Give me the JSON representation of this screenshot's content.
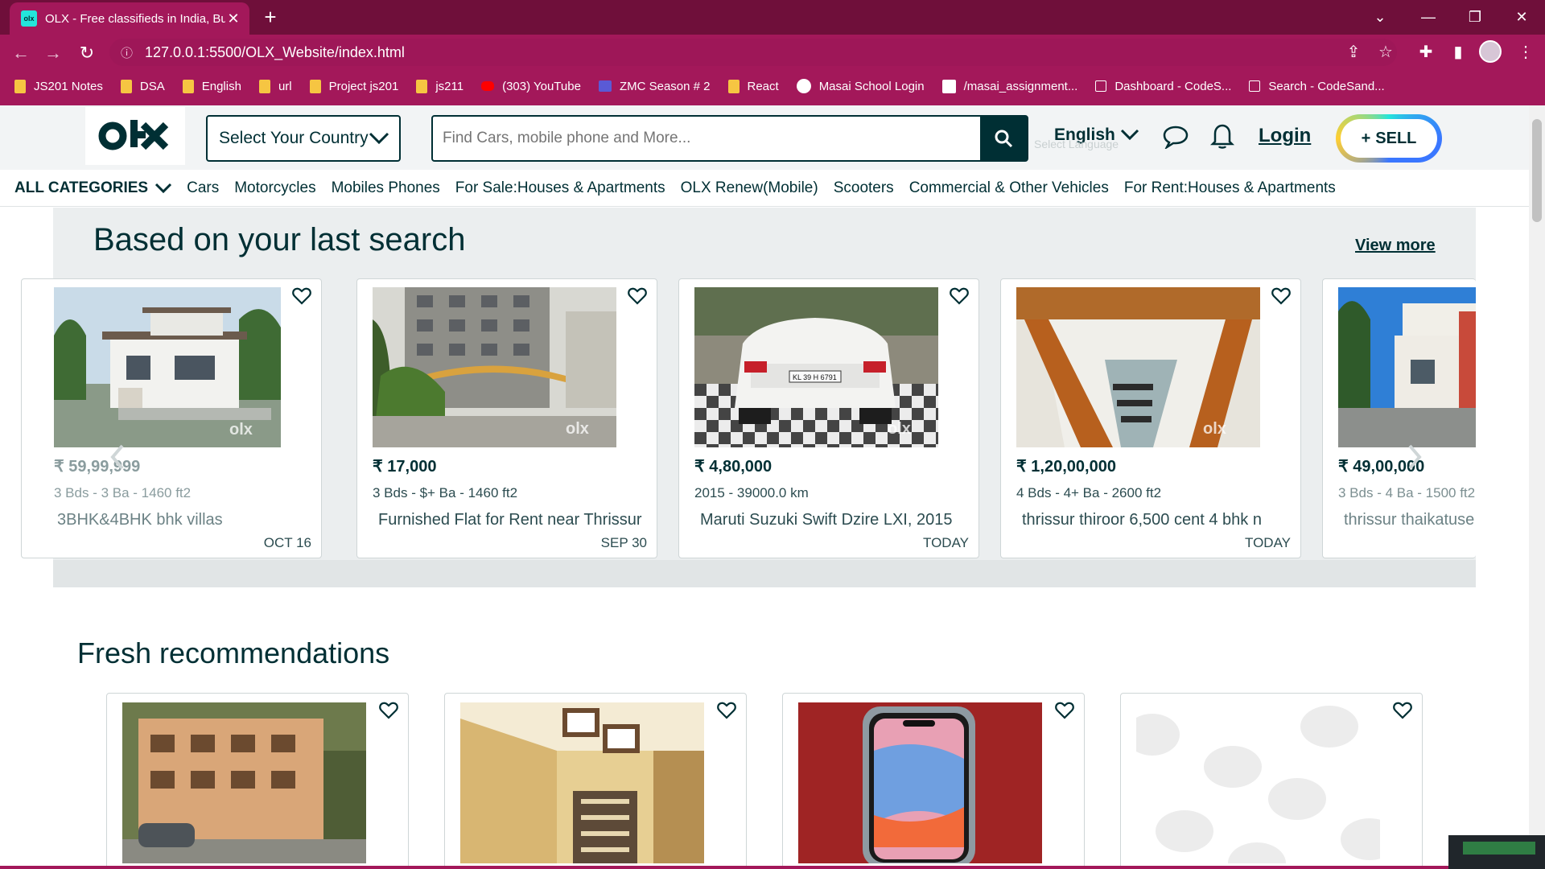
{
  "browser": {
    "tab_title": "OLX - Free classifieds in India, Bu",
    "tab_favicon": "olx",
    "url": "127.0.0.1:5500/OLX_Website/index.html",
    "bookmarks": [
      {
        "label": "JS201 Notes",
        "icon": "folder"
      },
      {
        "label": "DSA",
        "icon": "folder"
      },
      {
        "label": "English",
        "icon": "folder"
      },
      {
        "label": "url",
        "icon": "folder"
      },
      {
        "label": "Project js201",
        "icon": "folder"
      },
      {
        "label": "js211",
        "icon": "folder"
      },
      {
        "label": "(303) YouTube",
        "icon": "youtube"
      },
      {
        "label": "ZMC Season # 2",
        "icon": "zmc"
      },
      {
        "label": "React",
        "icon": "folder"
      },
      {
        "label": "Masai School Login",
        "icon": "masai"
      },
      {
        "label": "/masai_assignment...",
        "icon": "wikipedia"
      },
      {
        "label": "Dashboard - CodeS...",
        "icon": "page"
      },
      {
        "label": "Search - CodeSand...",
        "icon": "page"
      }
    ]
  },
  "header": {
    "logo_text": "OLX",
    "country_select": "Select Your Country",
    "search_placeholder": "Find Cars, mobile phone and More...",
    "language": "English",
    "language_widget": "Select Language",
    "login": "Login",
    "sell": "SELL",
    "sell_plus": "+"
  },
  "categories": {
    "all": "ALL CATEGORIES",
    "items": [
      "Cars",
      "Motorcycles",
      "Mobiles Phones",
      "For Sale:Houses & Apartments",
      "OLX Renew(Mobile)",
      "Scooters",
      "Commercial & Other Vehicles",
      "For Rent:Houses & Apartments"
    ]
  },
  "last_search": {
    "heading": "Based on your last search",
    "view_more": "View more",
    "cards": [
      {
        "price": "₹ 59,99,999",
        "spec": "3 Bds - 3 Ba - 1460 ft2",
        "title": "3BHK&4BHK bhk villas",
        "date": "OCT 16",
        "image": "villa"
      },
      {
        "price": "₹ 17,000",
        "spec": "3 Bds - $+ Ba - 1460 ft2",
        "title": "Furnished Flat for Rent near Thrissur",
        "date": "SEP 30",
        "image": "apartment"
      },
      {
        "price": "₹ 4,80,000",
        "spec": "2015 - 39000.0 km",
        "title": "Maruti Suzuki Swift Dzire LXI, 2015",
        "date": "TODAY",
        "image": "car"
      },
      {
        "price": "₹ 1,20,00,000",
        "spec": "4 Bds - 4+ Ba - 2600 ft2",
        "title": "thrissur thiroor 6,500 cent 4 bhk n",
        "date": "TODAY",
        "image": "stairs"
      },
      {
        "price": "₹ 49,00,000",
        "spec": "3 Bds - 4 Ba - 1500 ft2",
        "title": "thrissur thaikatuse villa",
        "date": "",
        "image": "house"
      }
    ]
  },
  "fresh": {
    "heading": "Fresh recommendations",
    "cards": [
      {
        "image": "building"
      },
      {
        "image": "interior"
      },
      {
        "image": "phone"
      },
      {
        "image": "placeholder"
      }
    ]
  },
  "colors": {
    "browser_frame": "#a3185a",
    "tab_strip": "#6f0f3a",
    "olx_dark": "#002f34",
    "olx_teal": "#23e5db",
    "olx_blue": "#3a77ff",
    "olx_yellow": "#ffce32"
  }
}
